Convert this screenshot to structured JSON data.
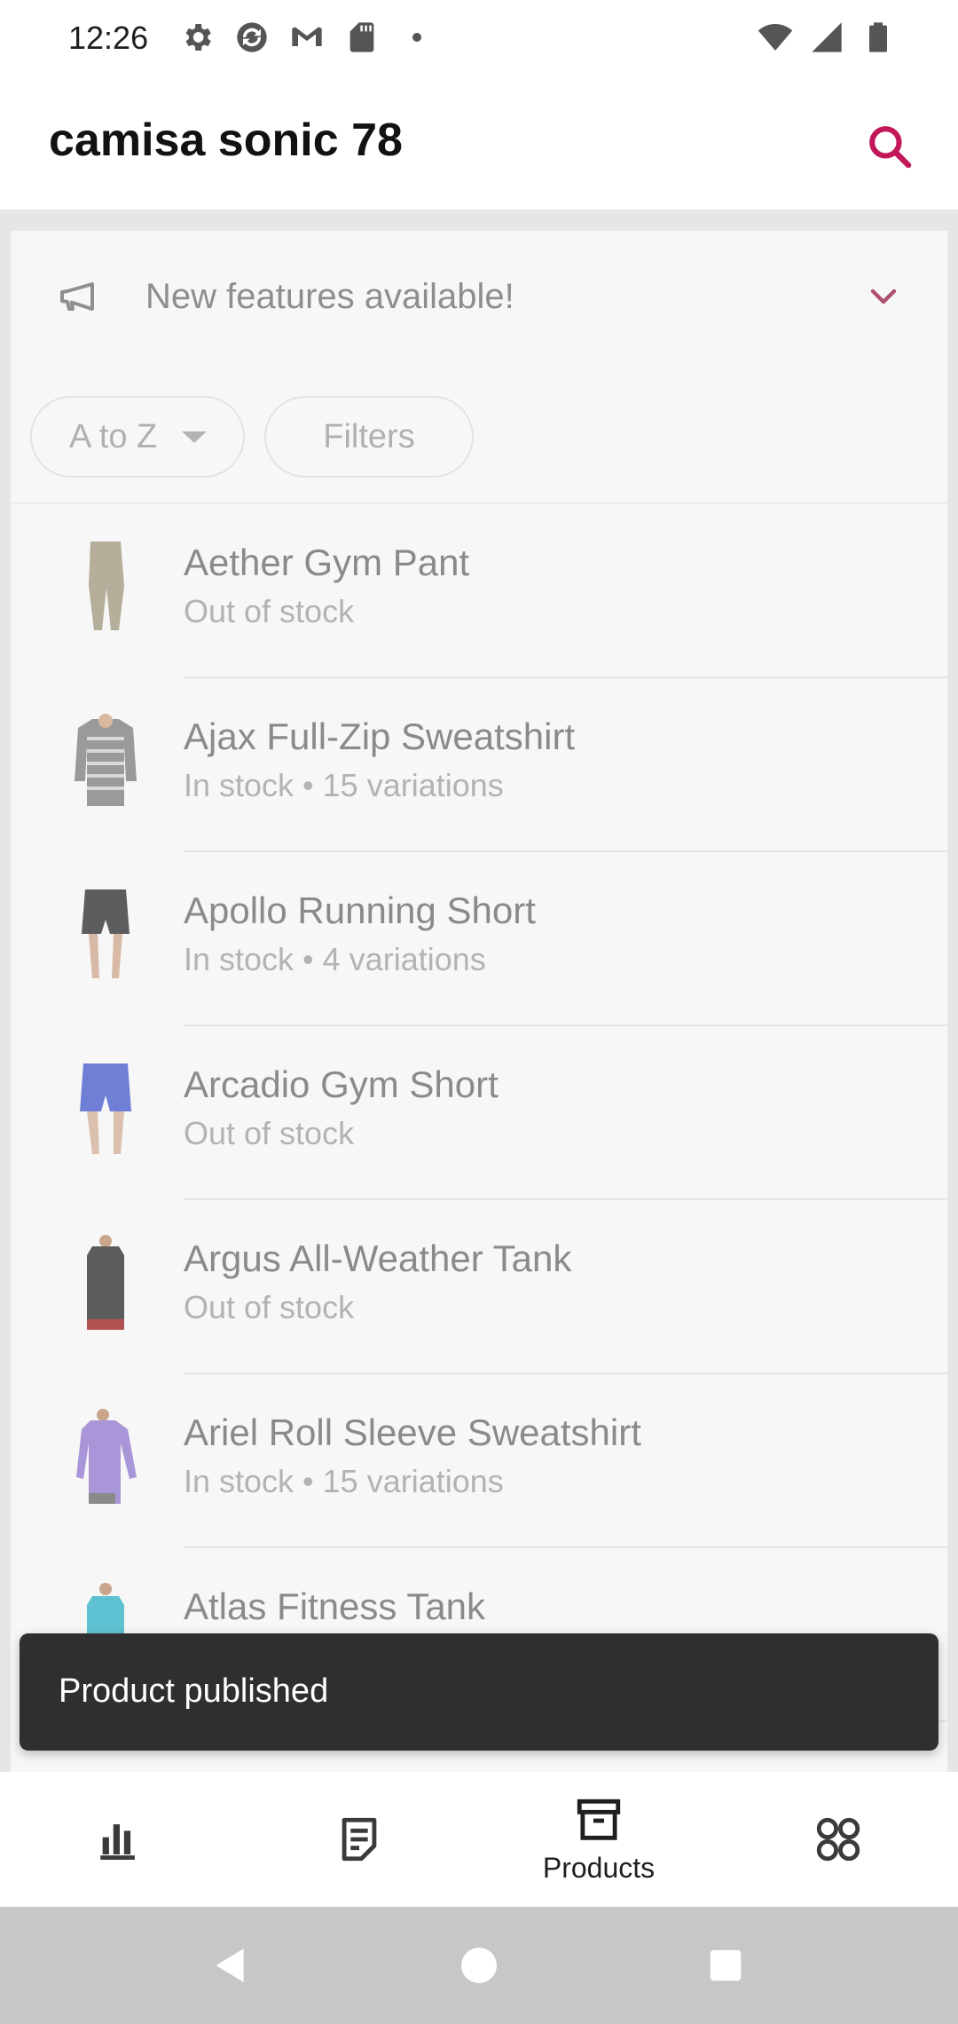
{
  "status_bar": {
    "time": "12:26",
    "icons_left": [
      "settings-icon",
      "sync-icon",
      "gmail-icon",
      "sd-card-icon",
      "dot-icon"
    ],
    "icons_right": [
      "wifi-icon",
      "signal-icon",
      "battery-icon"
    ]
  },
  "header": {
    "title": "camisa sonic 78",
    "search_icon": "search-icon",
    "accent_color": "#c2185b"
  },
  "banner": {
    "text": "New features available!",
    "icon": "megaphone-icon",
    "expand_icon": "chevron-down-icon"
  },
  "filters": {
    "sort_label": "A to Z",
    "filters_label": "Filters"
  },
  "products": [
    {
      "name": "Aether Gym Pant",
      "status": "Out of stock"
    },
    {
      "name": "Ajax Full-Zip Sweatshirt",
      "status": "In stock • 15 variations"
    },
    {
      "name": "Apollo Running Short",
      "status": "In stock • 4 variations"
    },
    {
      "name": "Arcadio Gym Short",
      "status": "Out of stock"
    },
    {
      "name": "Argus All-Weather Tank",
      "status": "Out of stock"
    },
    {
      "name": "Ariel Roll Sleeve Sweatshirt",
      "status": "In stock • 15 variations"
    },
    {
      "name": "Atlas Fitness Tank",
      "status": ""
    }
  ],
  "snackbar": {
    "text": "Product published"
  },
  "bottom_nav": {
    "items": [
      {
        "icon": "stats-icon",
        "label": ""
      },
      {
        "icon": "orders-icon",
        "label": ""
      },
      {
        "icon": "products-icon",
        "label": "Products"
      },
      {
        "icon": "more-icon",
        "label": ""
      }
    ],
    "selected": "Products"
  },
  "system_nav": {
    "icons": [
      "back-icon",
      "home-icon",
      "recents-icon"
    ]
  }
}
